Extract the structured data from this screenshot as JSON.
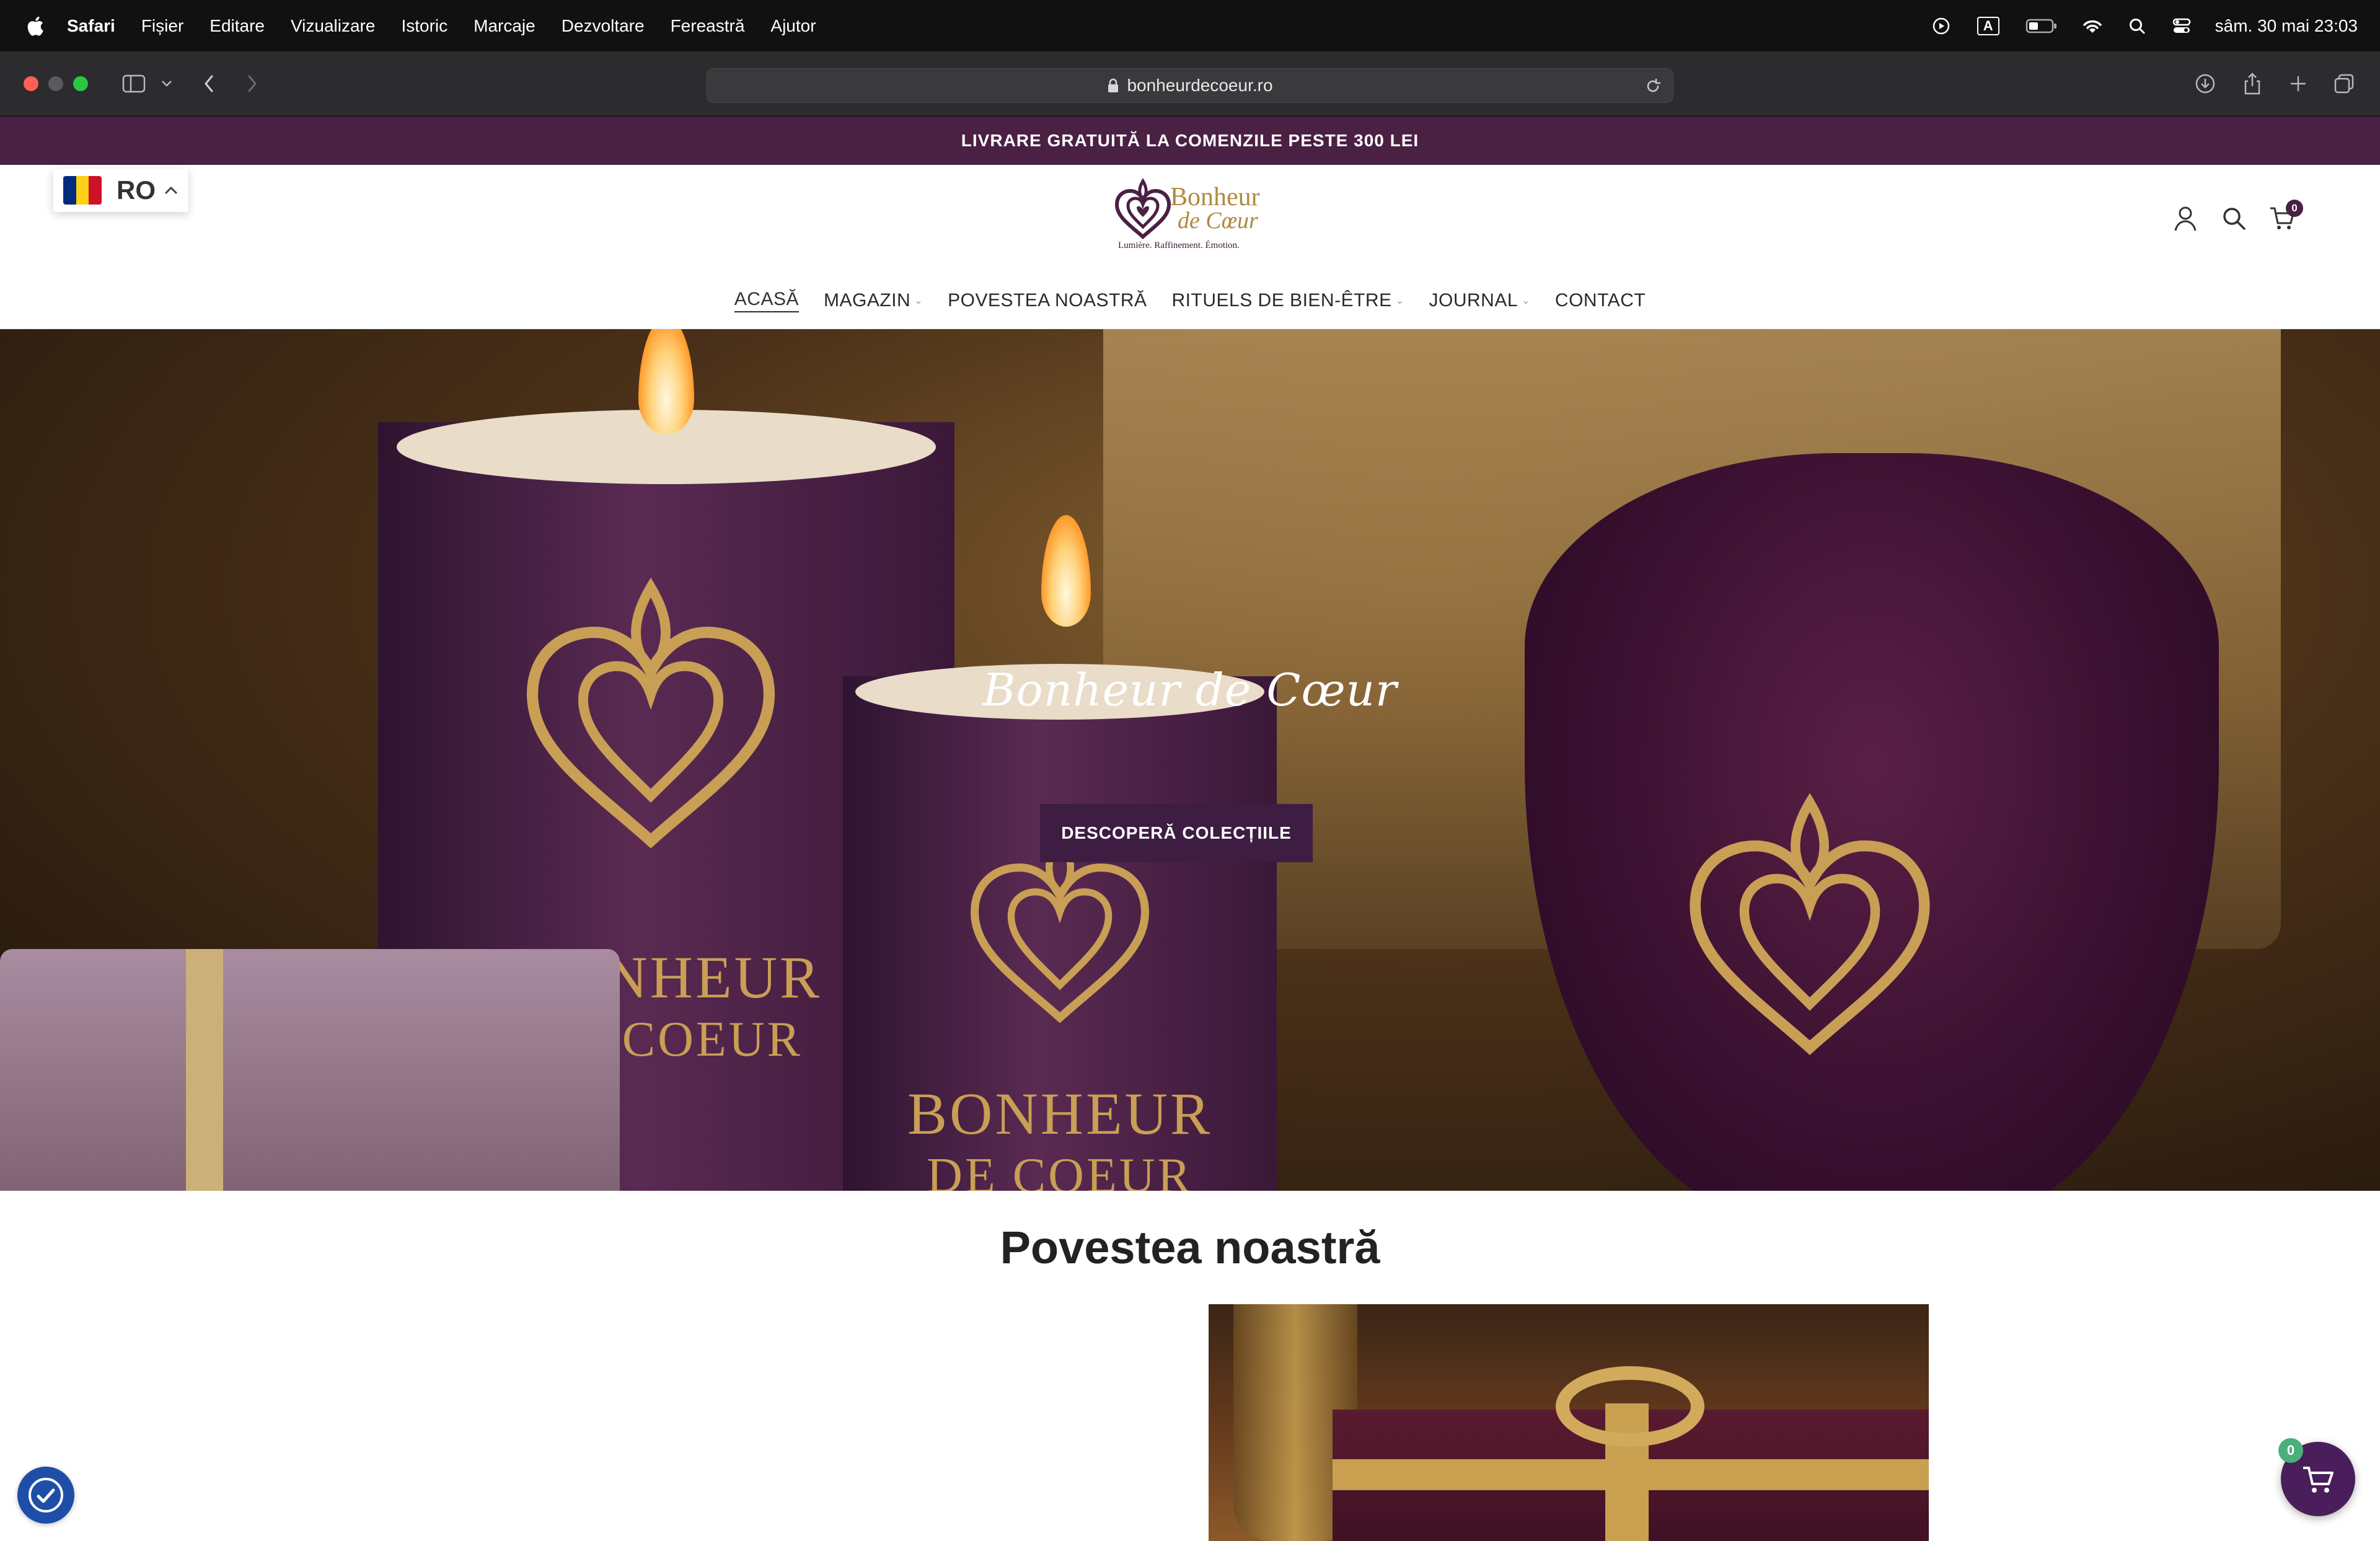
{
  "menubar": {
    "app_name": "Safari",
    "items": [
      "Fișier",
      "Editare",
      "Vizualizare",
      "Istoric",
      "Marcaje",
      "Dezvoltare",
      "Fereastră",
      "Ajutor"
    ],
    "clock": "sâm. 30 mai  23:03",
    "input_source": "A"
  },
  "browser": {
    "url": "bonheurdecoeur.ro"
  },
  "promo": {
    "text": "LIVRARE GRATUITĂ LA COMENZILE PESTE 300 LEI"
  },
  "header": {
    "language_code": "RO",
    "flag_colors": [
      "#002b7f",
      "#fcd116",
      "#ce1126"
    ],
    "logo_line1": "Bonheur",
    "logo_line2": "de Cœur",
    "logo_tagline": "Lumière. Raffinement. Émotion.",
    "cart_count": "0",
    "nav": [
      {
        "label": "ACASĂ",
        "active": true,
        "dropdown": false
      },
      {
        "label": "MAGAZIN",
        "active": false,
        "dropdown": true
      },
      {
        "label": "POVESTEA NOASTRĂ",
        "active": false,
        "dropdown": false
      },
      {
        "label": "RITUELS DE BIEN-ÊTRE",
        "active": false,
        "dropdown": true
      },
      {
        "label": "JOURNAL",
        "active": false,
        "dropdown": true
      },
      {
        "label": "CONTACT",
        "active": false,
        "dropdown": false
      }
    ]
  },
  "hero": {
    "title": "Bonheur de Cœur",
    "cta": "DESCOPERĂ COLECȚIILE",
    "candle_text_line1": "BONHEUR",
    "candle_text_line2": "DE COEUR"
  },
  "story": {
    "title": "Povestea noastră"
  },
  "floating_cart": {
    "count": "0"
  },
  "colors": {
    "brand_purple": "#4a2043",
    "button_purple": "#3e1d42",
    "gold": "#b08a3e",
    "a11y_blue": "#1f4ea8",
    "badge_green": "#4caf7a"
  }
}
